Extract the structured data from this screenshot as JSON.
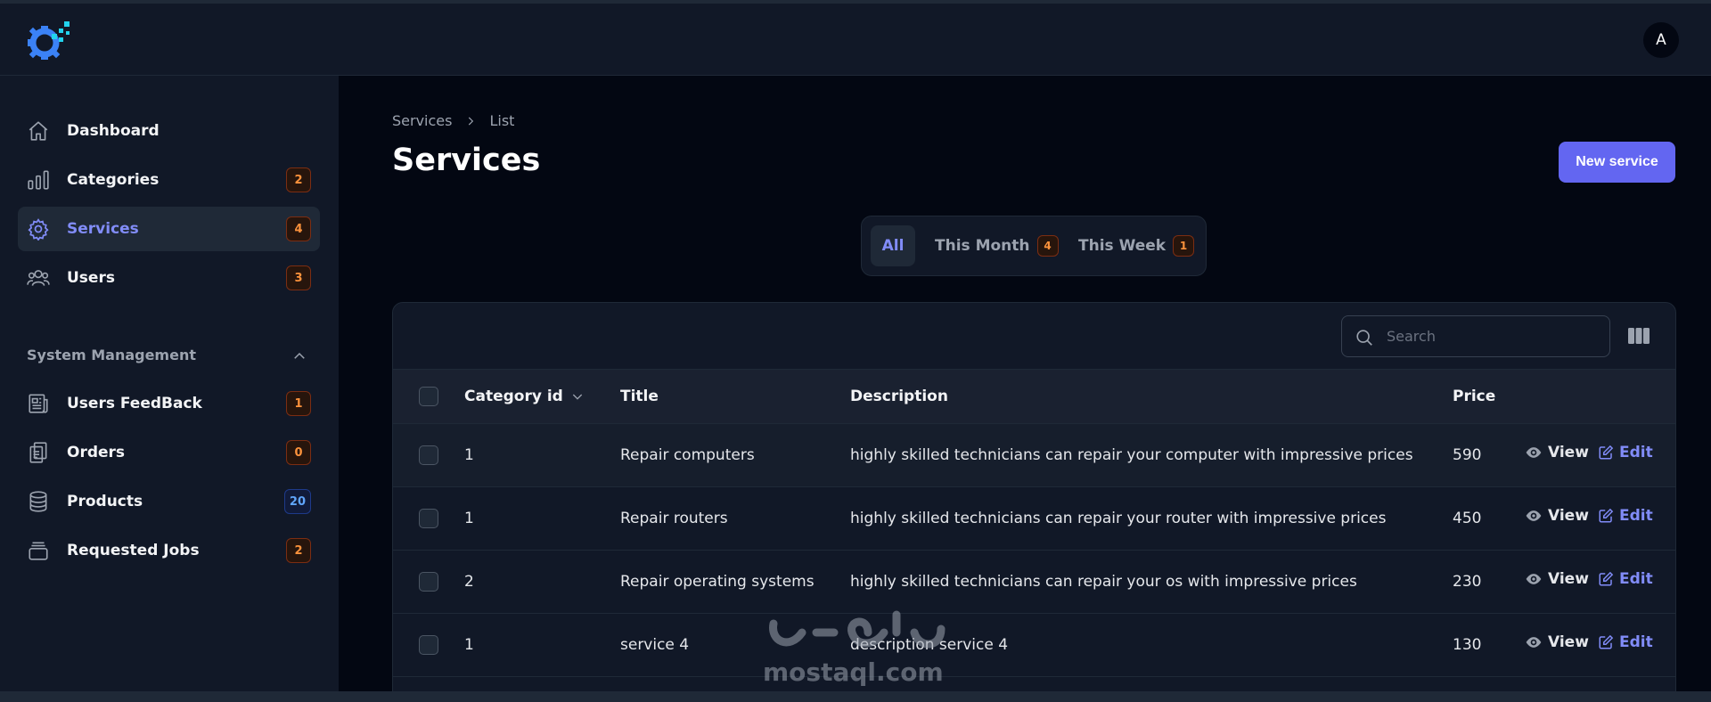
{
  "header": {
    "avatar_initial": "A"
  },
  "sidebar": {
    "items": [
      {
        "label": "Dashboard",
        "badge": null,
        "icon": "home-icon"
      },
      {
        "label": "Categories",
        "badge": "2",
        "icon": "bar-chart-icon"
      },
      {
        "label": "Services",
        "badge": "4",
        "icon": "gear-icon",
        "active": true
      },
      {
        "label": "Users",
        "badge": "3",
        "icon": "users-icon"
      }
    ],
    "group": {
      "title": "System Management",
      "items": [
        {
          "label": "Users FeedBack",
          "badge": "1",
          "icon": "newspaper-icon"
        },
        {
          "label": "Orders",
          "badge": "0",
          "icon": "clipboard-icon"
        },
        {
          "label": "Products",
          "badge": "20",
          "icon": "database-icon"
        },
        {
          "label": "Requested Jobs",
          "badge": "2",
          "icon": "archive-box-icon"
        }
      ]
    }
  },
  "breadcrumb": {
    "root": "Services",
    "current": "List"
  },
  "page": {
    "title": "Services",
    "new_button": "New service"
  },
  "tabs": [
    {
      "label": "All",
      "badge": null,
      "active": true
    },
    {
      "label": "This Month",
      "badge": "4"
    },
    {
      "label": "This Week",
      "badge": "1"
    }
  ],
  "table": {
    "search_placeholder": "Search",
    "columns": {
      "category": "Category id",
      "title": "Title",
      "description": "Description",
      "price": "Price"
    },
    "actions": {
      "view": "View",
      "edit": "Edit"
    },
    "rows": [
      {
        "category": "1",
        "title": "Repair computers",
        "description": "highly skilled technicians can repair your computer with impressive prices",
        "price": "590"
      },
      {
        "category": "1",
        "title": "Repair routers",
        "description": "highly skilled technicians can repair your router with impressive prices",
        "price": "450"
      },
      {
        "category": "2",
        "title": "Repair operating systems",
        "description": "highly skilled technicians can repair your os with impressive prices",
        "price": "230"
      },
      {
        "category": "1",
        "title": "service 4",
        "description": "description service 4",
        "price": "130"
      }
    ]
  },
  "watermark": {
    "text": "mostaql.com"
  },
  "colors": {
    "accent": "#6366f1",
    "active_text": "#818cf8",
    "badge_orange": "#fb923c",
    "badge_blue": "#60a5fa"
  }
}
